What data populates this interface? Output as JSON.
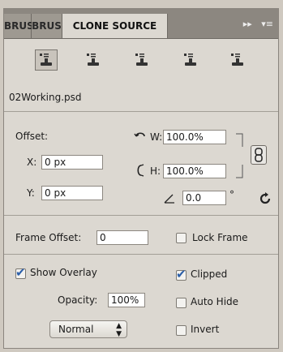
{
  "tabs": [
    {
      "label": "BRUS"
    },
    {
      "label": "BRUS"
    },
    {
      "label": "CLONE SOURCE"
    }
  ],
  "tabbar": {
    "collapse": "▸▸",
    "menu": "▾≡"
  },
  "file": {
    "name": "02Working.psd"
  },
  "offset": {
    "label": "Offset:",
    "x_label": "X:",
    "x_value": "0 px",
    "y_label": "Y:",
    "y_value": "0 px",
    "w_label": "W:",
    "w_value": "100.0%",
    "h_label": "H:",
    "h_value": "100.0%",
    "angle_value": "0.0",
    "degree": "°"
  },
  "frame": {
    "label": "Frame Offset:",
    "value": "0",
    "lock_label": "Lock Frame",
    "lock_checked": false
  },
  "overlay": {
    "show_label": "Show Overlay",
    "show_checked": true,
    "clipped_label": "Clipped",
    "clipped_checked": true,
    "opacity_label": "Opacity:",
    "opacity_value": "100%",
    "autohide_label": "Auto Hide",
    "autohide_checked": false,
    "invert_label": "Invert",
    "invert_checked": false,
    "blend_mode": "Normal"
  },
  "colors": {
    "accent": "#2b5ea8",
    "tabbar": "#8c8780",
    "panel": "#dcd8d1"
  }
}
